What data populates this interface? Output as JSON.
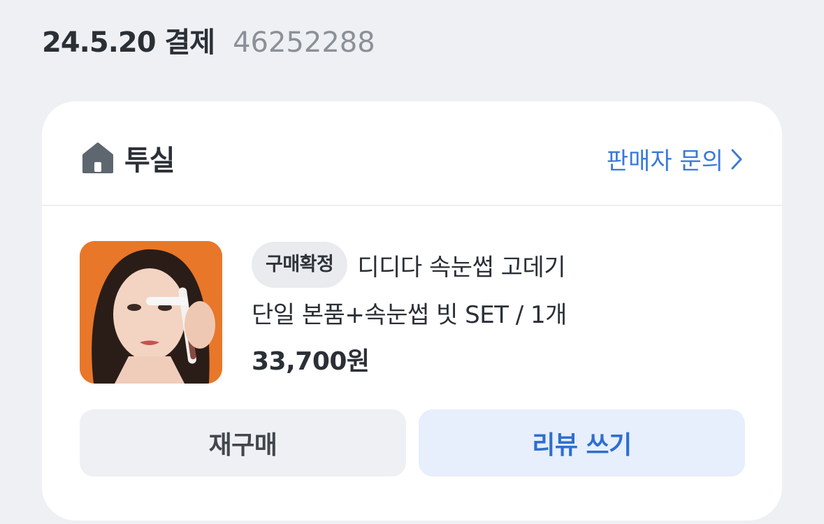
{
  "order": {
    "date_label": "24.5.20 결제",
    "order_number": "46252288"
  },
  "seller": {
    "icon": "home-icon",
    "name": "투실",
    "inquiry_label": "판매자 문의",
    "link_color": "#3a7ad9"
  },
  "product": {
    "status_badge": "구매확정",
    "name": "디디다 속눈썹 고데기",
    "option": "단일 본품+속눈썹 빗 SET / 1개",
    "price": "33,700원",
    "image_alt": "product-photo"
  },
  "actions": {
    "rebuy_label": "재구매",
    "review_label": "리뷰 쓰기",
    "review_color": "#2f6ed0"
  }
}
